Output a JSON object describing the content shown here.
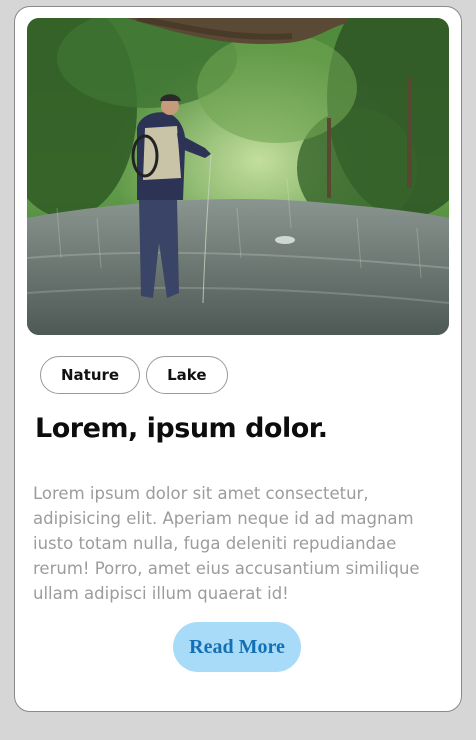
{
  "card": {
    "image": {
      "subject": "fly-fisherman-wading-in-river-photo"
    },
    "tags": [
      {
        "label": "Nature"
      },
      {
        "label": "Lake"
      }
    ],
    "title": "Lorem, ipsum dolor.",
    "description": "Lorem ipsum dolor sit amet consectetur, adipisicing elit. Aperiam neque id ad magnam iusto totam nulla, fuga deleniti repudiandae rerum! Porro, amet eius accusantium similique ullam adipisci illum quaerat id!",
    "button_label": "Read More"
  },
  "colors": {
    "page_background": "#d6d6d6",
    "card_background": "#ffffff",
    "button_background": "#a8dbf7",
    "button_text": "#1470b5",
    "description_text": "#9c9c9c"
  }
}
